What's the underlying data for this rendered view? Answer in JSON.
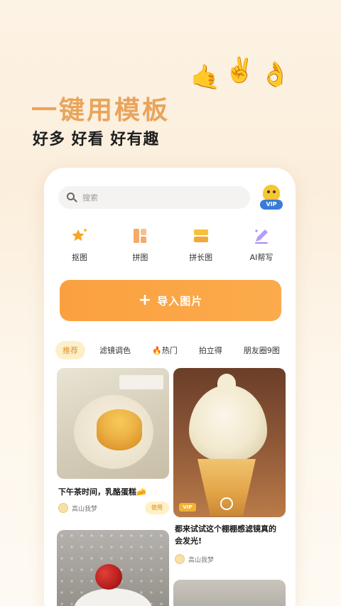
{
  "promo": {
    "title": "一键用模板",
    "subtitle": "好多 好看 好有趣",
    "hand_emojis": [
      "🤙",
      "✌️",
      "👌"
    ]
  },
  "search": {
    "placeholder": "搜索"
  },
  "vip": {
    "label": "VIP"
  },
  "tools": [
    {
      "label": "抠图",
      "icon": "star-sparkle-icon",
      "color": "#f5a623"
    },
    {
      "label": "拼图",
      "icon": "grid-layout-icon",
      "color": "#f5a96a"
    },
    {
      "label": "拼长图",
      "icon": "stack-layout-icon",
      "color": "#f5c13a"
    },
    {
      "label": "AI帮写",
      "icon": "ai-pen-icon",
      "color": "#a88cf0"
    }
  ],
  "import_button": {
    "icon": "+",
    "label": "导入图片"
  },
  "tabs": [
    {
      "label": "推荐",
      "active": true
    },
    {
      "label": "滤镜调色",
      "active": false
    },
    {
      "label": "热门",
      "active": false,
      "prefix": "🔥"
    },
    {
      "label": "拍立得",
      "active": false
    },
    {
      "label": "朋友圈9图",
      "active": false
    }
  ],
  "cards": [
    {
      "title": "下午茶时间，乳酪蛋糕🧀",
      "user": "高山我梦",
      "action": "使用"
    },
    {
      "title": "都来试试这个棚棚感滤镜真的会发光!",
      "user": "高山我梦",
      "badge": "VIP"
    },
    {
      "title": "",
      "user": ""
    }
  ],
  "colors": {
    "accent": "#fba040",
    "promo_title": "#e9a45c",
    "tab_active_bg": "#fdf0c9",
    "tab_active_text": "#e0942c"
  }
}
